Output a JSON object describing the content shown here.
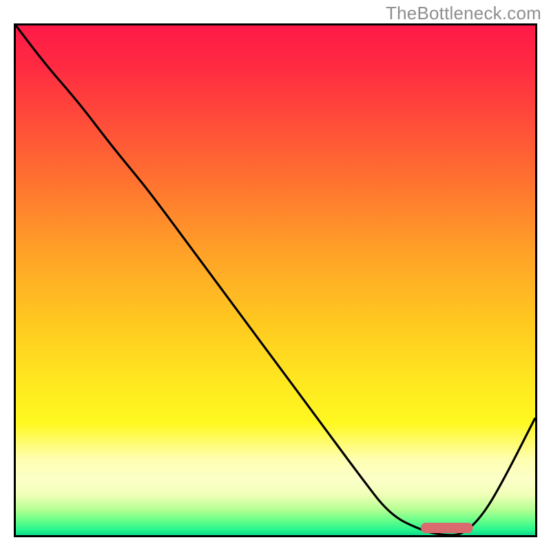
{
  "attribution": "TheBottleneck.com",
  "colors": {
    "gradient_top": "#ff1a47",
    "gradient_mid": "#ffe820",
    "gradient_bottom": "#0fd98a",
    "curve": "#000000",
    "marker": "#d96a6e",
    "border": "#000000",
    "attribution_text": "#8e8e8e"
  },
  "chart_data": {
    "type": "line",
    "title": "",
    "xlabel": "",
    "ylabel": "",
    "xlim": [
      0,
      100
    ],
    "ylim": [
      0,
      100
    ],
    "series": [
      {
        "name": "bottleneck-curve",
        "x": [
          0,
          6,
          12,
          18,
          22,
          26,
          34,
          42,
          50,
          58,
          66,
          72,
          78,
          82,
          86,
          90,
          94,
          100
        ],
        "y": [
          100,
          92,
          85,
          77,
          72,
          67,
          56,
          45,
          34,
          23,
          12,
          4,
          1,
          0,
          0,
          4,
          11,
          23
        ]
      }
    ],
    "marker": {
      "name": "optimal-point",
      "x_range": [
        78,
        88
      ],
      "y": 0,
      "shape": "rounded-bar"
    },
    "annotations": []
  }
}
